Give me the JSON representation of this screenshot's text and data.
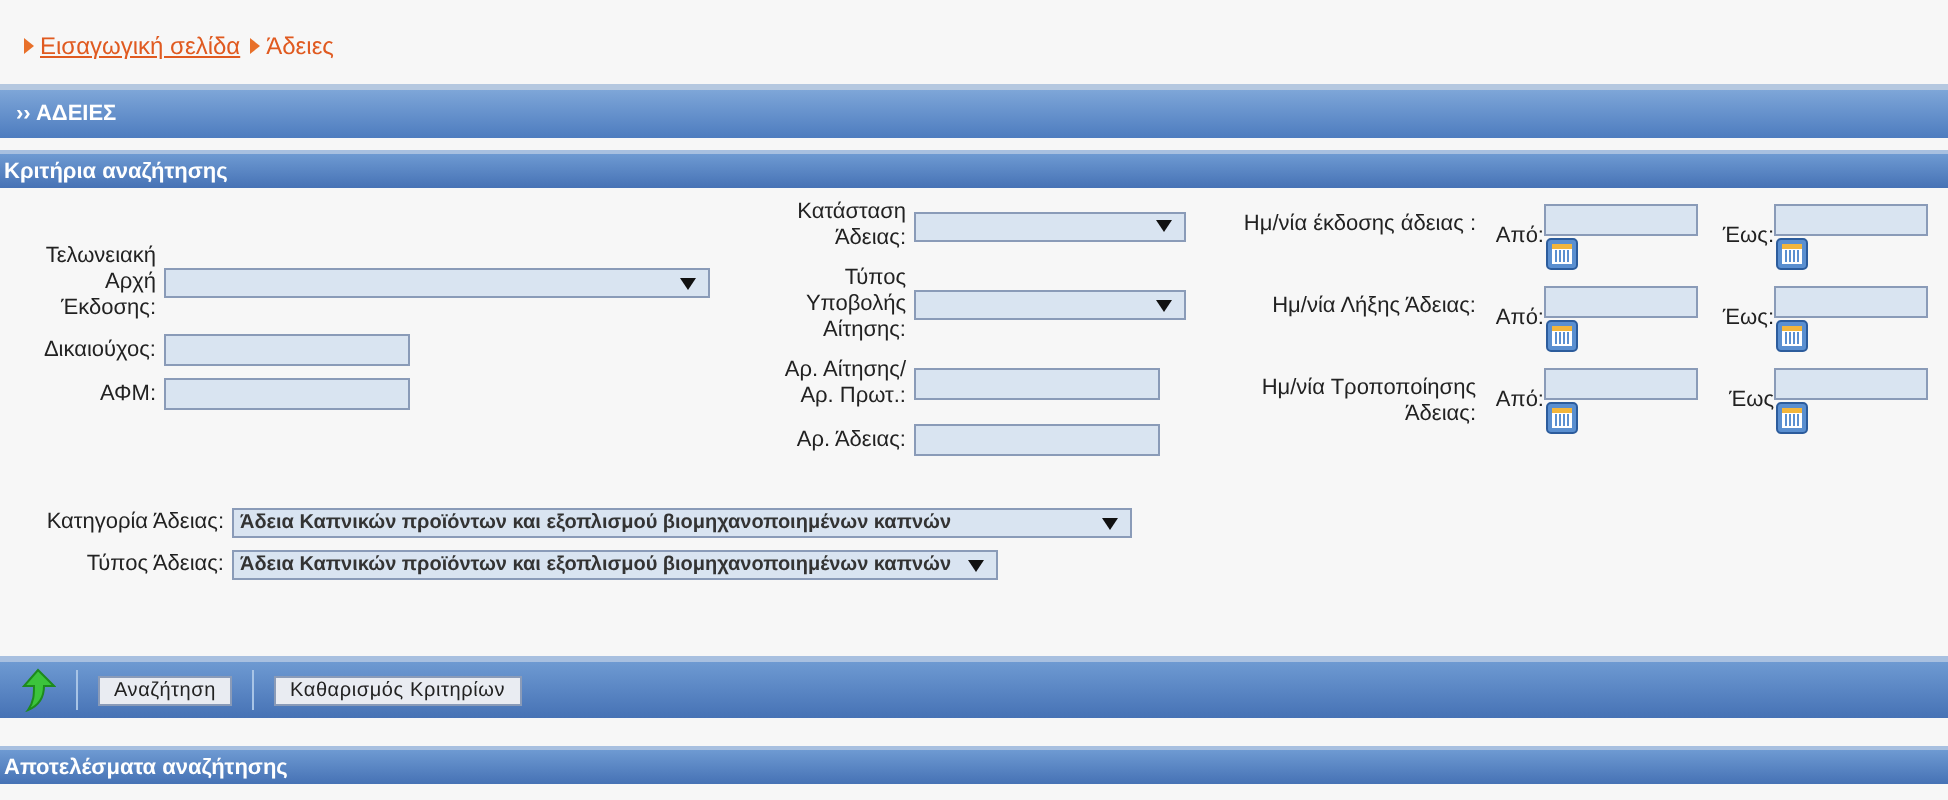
{
  "breadcrumb": [
    {
      "label": "Εισαγωγική σελίδα"
    },
    {
      "label": "Άδειες"
    }
  ],
  "page_title": "›› ΑΔΕΙΕΣ",
  "criteria_title": "Κριτήρια αναζήτησης",
  "column_1": [
    {
      "kind": "select",
      "label": "Τελωνειακή Αρχή Έκδοσης:"
    },
    {
      "kind": "text",
      "label": "Δικαιούχος:"
    },
    {
      "kind": "text",
      "label": "ΑΦΜ:"
    }
  ],
  "column_2": [
    {
      "kind": "select",
      "label": "Κατάσταση Άδειας:"
    },
    {
      "kind": "select",
      "label": "Τύπος Υποβολής Αίτησης:"
    },
    {
      "kind": "text",
      "label": "Αρ. Αίτησης/Αρ. Πρωτ.:"
    },
    {
      "kind": "text",
      "label": "Αρ. Άδειας:"
    }
  ],
  "date_ranges": [
    {
      "label": "Ημ/νία έκδοσης άδειας :",
      "from_label": "Από:",
      "to_label": "Έως:"
    },
    {
      "label": "Ημ/νία Λήξης Άδειας:",
      "from_label": "Από:",
      "to_label": "Έως:"
    },
    {
      "label": "Ημ/νία Τροποποίησης Άδειας:",
      "from_label": "Από:",
      "to_label": "Έως"
    }
  ],
  "bottom_selects": [
    {
      "label": "Κατηγορία Άδειας:",
      "value": "Άδεια Καπνικών προϊόντων και εξοπλισμού βιομηχανοποιημένων καπνών"
    },
    {
      "label": "Τύπος Άδειας:",
      "value": "Άδεια Καπνικών προϊόντων και εξοπλισμού βιομηχανοποιημένων καπνών"
    }
  ],
  "toolbar_buttons": [
    "Αναζήτηση",
    "Καθαρισμός Κριτηρίων"
  ],
  "results_title": "Αποτελέσματα αναζήτησης"
}
